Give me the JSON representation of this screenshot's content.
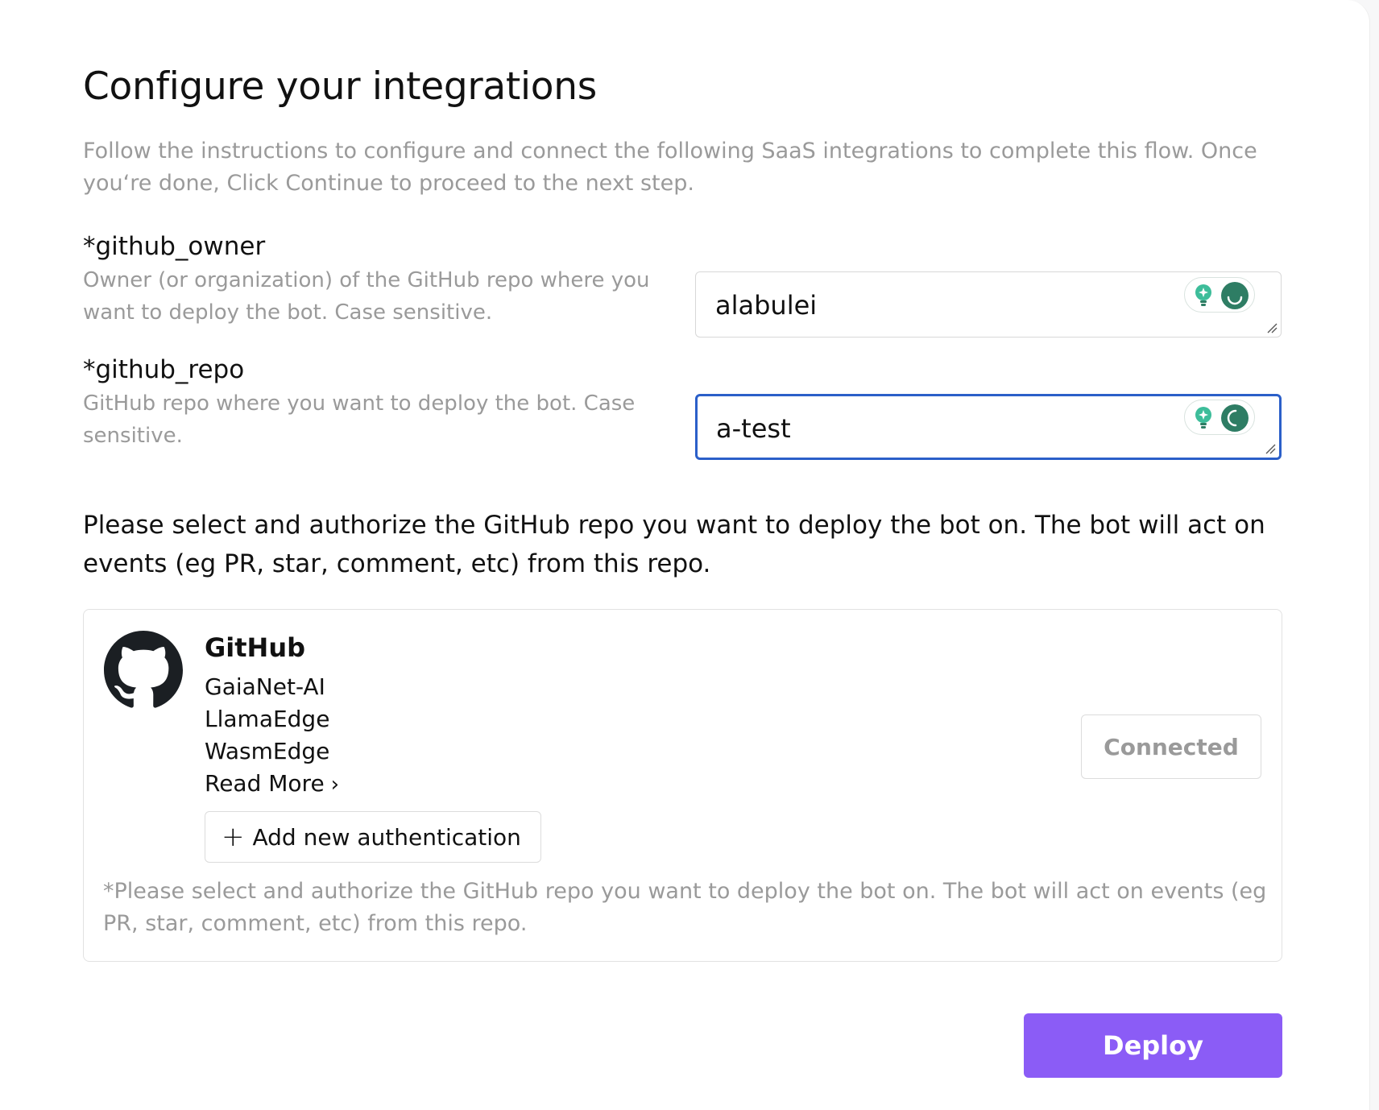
{
  "page": {
    "title": "Configure your integrations",
    "subtitle": "Follow the instructions to configure and connect the following SaaS integrations to complete this flow. Once you‘re done, Click Continue to proceed to the next step."
  },
  "fields": [
    {
      "label": "*github_owner",
      "description": "Owner (or organization) of the GitHub repo where you want to deploy the bot. Case sensitive.",
      "value": "alabulei",
      "focused": false
    },
    {
      "label": "*github_repo",
      "description": "GitHub repo where you want to deploy the bot. Case sensitive.",
      "value": "a-test",
      "focused": true
    }
  ],
  "instruction": "Please select and authorize the GitHub repo you want to deploy the bot on. The bot will act on events (eg PR, star, comment, etc) from this repo.",
  "integration": {
    "name": "GitHub",
    "icon": "github-icon",
    "organizations": [
      "GaiaNet-AI",
      "LlamaEdge",
      "WasmEdge"
    ],
    "read_more": "Read More",
    "add_auth_label": "Add new authentication",
    "status_label": "Connected",
    "note": "*Please select and authorize the GitHub repo you want to deploy the bot on. The bot will act on events (eg PR, star, comment, etc) from this repo."
  },
  "actions": {
    "deploy_label": "Deploy"
  },
  "colors": {
    "accent": "#8b5cf6",
    "focus_border": "#2b5fc9",
    "muted_text": "#9a9a9a",
    "extension_green": "#2e7d64"
  }
}
